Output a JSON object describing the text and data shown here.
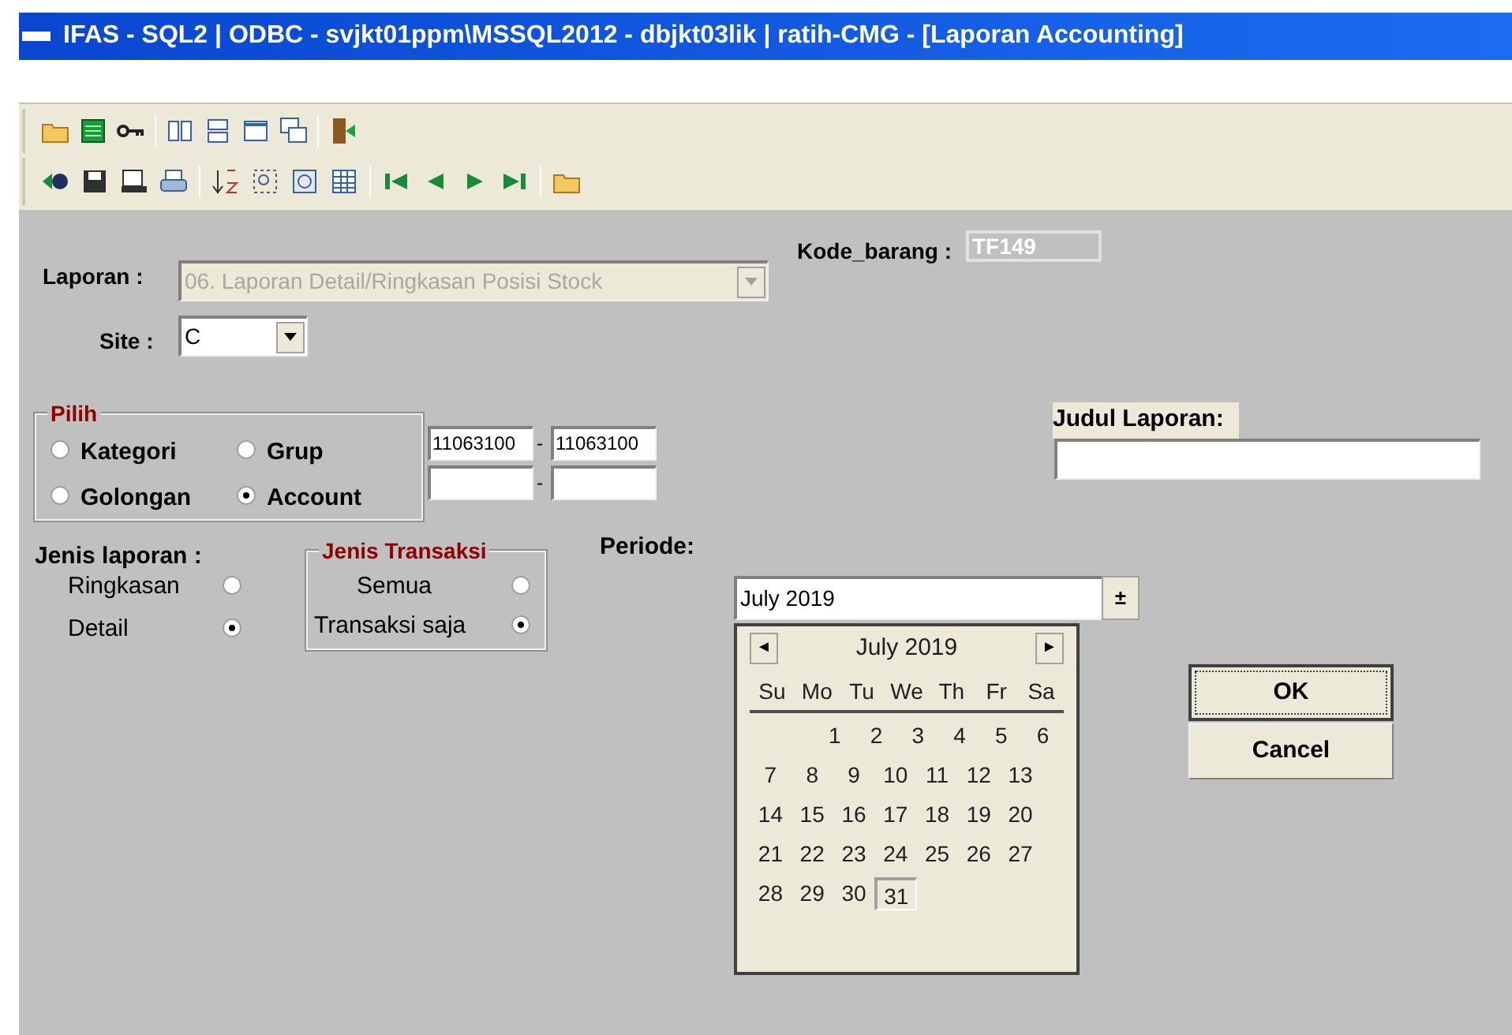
{
  "window": {
    "title": "IFAS - SQL2 | ODBC - svjkt01ppm\\MSSQL2012 - dbjkt03lik | ratih-CMG - [Laporan Accounting]"
  },
  "form": {
    "laporan": {
      "label": "Laporan :",
      "value": "06. Laporan Detail/Ringkasan Posisi Stock",
      "disabled": true
    },
    "kode_barang": {
      "label": "Kode_barang :",
      "value": "TF149",
      "disabled": true
    },
    "site": {
      "label": "Site :",
      "value": "C"
    },
    "pilih": {
      "title": "Pilih",
      "options": [
        {
          "label": "Kategori",
          "selected": false
        },
        {
          "label": "Grup",
          "selected": false
        },
        {
          "label": "Golongan",
          "selected": false
        },
        {
          "label": "Account",
          "selected": true
        }
      ]
    },
    "ranges": [
      {
        "from": "11063100",
        "separator": "-",
        "to": "11063100"
      },
      {
        "separator": "-"
      }
    ],
    "judul_laporan": {
      "label": "Judul Laporan:"
    },
    "jenis_laporan": {
      "label": "Jenis laporan :",
      "options": [
        {
          "label": "Ringkasan",
          "selected": false
        },
        {
          "label": "Detail",
          "selected": true
        }
      ]
    },
    "jenis_transaksi": {
      "title": "Jenis Transaksi",
      "options": [
        {
          "label": "Semua",
          "selected": false
        },
        {
          "label": "Transaksi saja",
          "selected": true
        }
      ]
    },
    "periode": {
      "label": "Periode:",
      "value": "July 2019",
      "button": "±"
    },
    "calendar": {
      "prev": "◄",
      "month": "July 2019",
      "next": "►",
      "weekdays": [
        "Su",
        "Mo",
        "Tu",
        "We",
        "Th",
        "Fr",
        "Sa"
      ],
      "weeks": [
        [
          {
            "day": "1",
            "selected": false
          },
          {
            "day": "2",
            "selected": false
          },
          {
            "day": "3",
            "selected": false
          },
          {
            "day": "4",
            "selected": false
          },
          {
            "day": "5",
            "selected": false
          },
          {
            "day": "6",
            "selected": false
          }
        ],
        [
          {
            "day": "7",
            "selected": false
          },
          {
            "day": "8",
            "selected": false
          },
          {
            "day": "9",
            "selected": false
          },
          {
            "day": "10",
            "selected": false
          },
          {
            "day": "11",
            "selected": false
          },
          {
            "day": "12",
            "selected": false
          },
          {
            "day": "13",
            "selected": false
          }
        ],
        [
          {
            "day": "14",
            "selected": false
          },
          {
            "day": "15",
            "selected": false
          },
          {
            "day": "16",
            "selected": false
          },
          {
            "day": "17",
            "selected": false
          },
          {
            "day": "18",
            "selected": false
          },
          {
            "day": "19",
            "selected": false
          },
          {
            "day": "20",
            "selected": false
          }
        ],
        [
          {
            "day": "21",
            "selected": false
          },
          {
            "day": "22",
            "selected": false
          },
          {
            "day": "23",
            "selected": false
          },
          {
            "day": "24",
            "selected": false
          },
          {
            "day": "25",
            "selected": false
          },
          {
            "day": "26",
            "selected": false
          },
          {
            "day": "27",
            "selected": false
          }
        ],
        [
          {
            "day": "28",
            "selected": false
          },
          {
            "day": "29",
            "selected": false
          },
          {
            "day": "30",
            "selected": false
          },
          {
            "day": "31",
            "selected": true
          }
        ]
      ]
    },
    "buttons": [
      {
        "label": "OK",
        "default": true
      },
      {
        "label": "Cancel",
        "default": false
      }
    ]
  }
}
